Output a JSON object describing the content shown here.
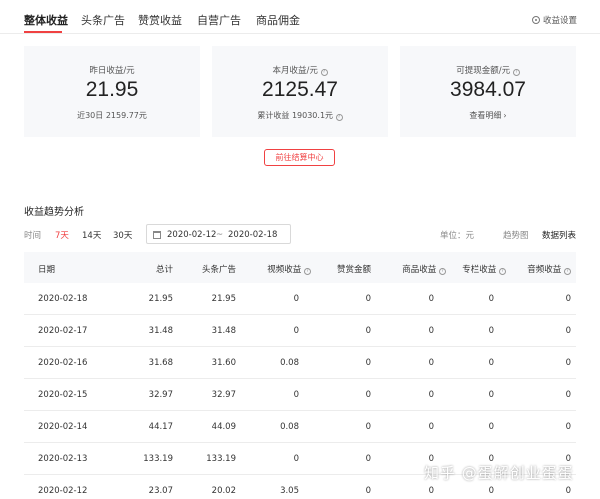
{
  "tabs": [
    {
      "label": "整体收益",
      "active": true
    },
    {
      "label": "头条广告",
      "active": false
    },
    {
      "label": "赞赏收益",
      "active": false
    },
    {
      "label": "自营广告",
      "active": false
    },
    {
      "label": "商品佣金",
      "active": false
    }
  ],
  "settings_label": "收益设置",
  "cards": {
    "yesterday": {
      "label": "昨日收益/元",
      "value": "21.95",
      "sub": "近30日 2159.77元"
    },
    "month": {
      "label": "本月收益/元",
      "value": "2125.47",
      "sub": "累计收益 19030.1元"
    },
    "withdrawable": {
      "label": "可提现金额/元",
      "value": "3984.07",
      "sub": "查看明细"
    }
  },
  "goto_settlement": "前往结算中心",
  "trend_title": "收益趋势分析",
  "filter": {
    "time_label": "时间",
    "ranges": [
      "7天",
      "14天",
      "30天"
    ],
    "active_range": "7天",
    "date_from": "2020-02-12",
    "date_sep": "~",
    "date_to": "2020-02-18",
    "unit": "单位：元",
    "view_trend": "趋势图",
    "view_list": "数据列表"
  },
  "table": {
    "headers": [
      "日期",
      "总计",
      "头条广告",
      "视频收益",
      "赞赏金额",
      "商品收益",
      "专栏收益",
      "音频收益"
    ],
    "rows": [
      [
        "2020-02-18",
        "21.95",
        "21.95",
        "0",
        "0",
        "0",
        "0",
        "0"
      ],
      [
        "2020-02-17",
        "31.48",
        "31.48",
        "0",
        "0",
        "0",
        "0",
        "0"
      ],
      [
        "2020-02-16",
        "31.68",
        "31.60",
        "0.08",
        "0",
        "0",
        "0",
        "0"
      ],
      [
        "2020-02-15",
        "32.97",
        "32.97",
        "0",
        "0",
        "0",
        "0",
        "0"
      ],
      [
        "2020-02-14",
        "44.17",
        "44.09",
        "0.08",
        "0",
        "0",
        "0",
        "0"
      ],
      [
        "2020-02-13",
        "133.19",
        "133.19",
        "0",
        "0",
        "0",
        "0",
        "0"
      ],
      [
        "2020-02-12",
        "23.07",
        "20.02",
        "3.05",
        "0",
        "0",
        "0",
        "0"
      ]
    ]
  },
  "watermark": "知乎 @蛋解创业蛋蛋",
  "colors": {
    "accent": "#f04142",
    "card_bg": "#f7f8fa"
  }
}
